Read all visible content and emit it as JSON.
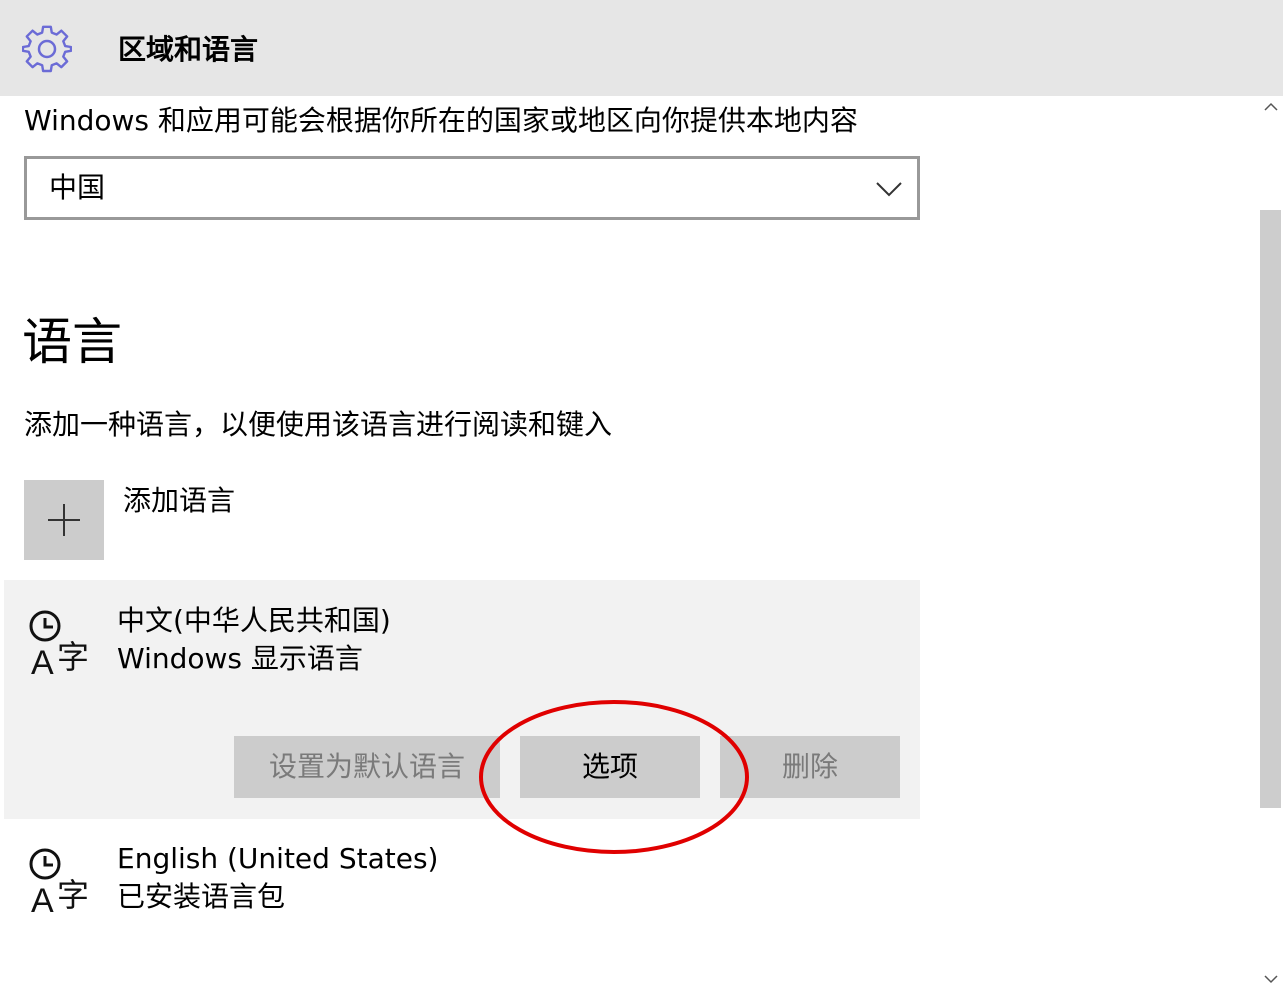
{
  "titlebar": {
    "icon": "gear-icon",
    "title": "区域和语言"
  },
  "region": {
    "description": "Windows 和应用可能会根据你所在的国家或地区向你提供本地内容",
    "selected_country": "中国",
    "dropdown_icon": "chevron-down-icon"
  },
  "languages": {
    "heading": "语言",
    "description": "添加一种语言，以便使用该语言进行阅读和键入",
    "add_label": "添加语言",
    "add_icon": "plus-icon",
    "items": [
      {
        "name": "中文(中华人民共和国)",
        "status": "Windows 显示语言",
        "icon": "language-icon",
        "selected": true,
        "buttons": {
          "set_default": "设置为默认语言",
          "options": "选项",
          "remove": "删除"
        }
      },
      {
        "name": "English (United States)",
        "status": "已安装语言包",
        "icon": "language-icon",
        "selected": false
      }
    ]
  },
  "scrollbar": {
    "up_arrow": "scroll-up-arrow",
    "down_arrow": "scroll-down-arrow"
  },
  "colors": {
    "titlebar_bg": "#e6e6e6",
    "gear_icon": "#6b6bd6",
    "button_bg": "#cccccc",
    "selected_item_bg": "#f2f2f2",
    "highlight_annotation": "#e00000"
  }
}
